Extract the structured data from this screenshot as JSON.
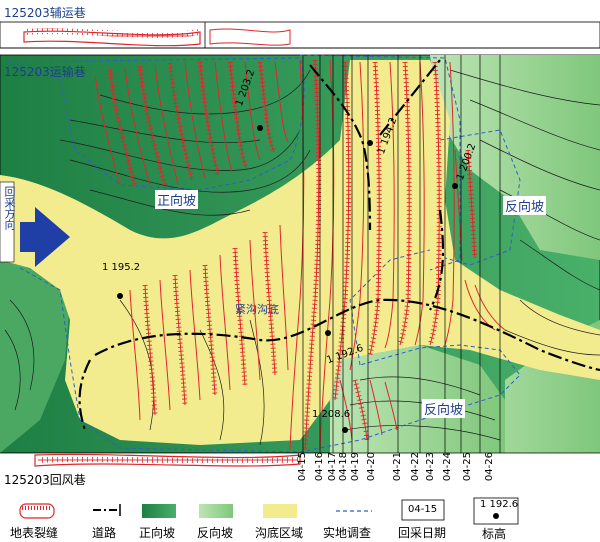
{
  "roads": {
    "aux": "125203辅运巷",
    "transport": "125203运输巷",
    "return_air": "125203回风巷"
  },
  "labels": {
    "forward_slope_1": "正向坡",
    "reverse_slope_1": "反向坡",
    "reverse_slope_2": "反向坡",
    "gully_bottom": "紧沟沟底",
    "mining_direction": "回采方向"
  },
  "elevations": [
    "1 203.2",
    "1 194.2",
    "1 200.2",
    "1 195.2",
    "1 192.6",
    "1 208.6"
  ],
  "dates": [
    "04-15",
    "04-16",
    "04-17",
    "04-18",
    "04-19",
    "04-20",
    "04-21",
    "04-22",
    "04-23",
    "04-24",
    "04-25",
    "04-26"
  ],
  "legend": {
    "crack": "地表裂缝",
    "road": "道路",
    "forward": "正向坡",
    "reverse": "反向坡",
    "gully": "沟底区域",
    "survey": "实地调查",
    "date_box": "04-15",
    "date_label": "回采日期",
    "elev_box": "1 192.6",
    "elev_label": "标高"
  },
  "colors": {
    "forward_slope": "#2f9a57",
    "reverse_slope": "#9dd393",
    "gully": "#f2ec8f",
    "crack": "#e0262b",
    "survey": "#2e5fc8",
    "arrow": "#1f3fa6"
  }
}
